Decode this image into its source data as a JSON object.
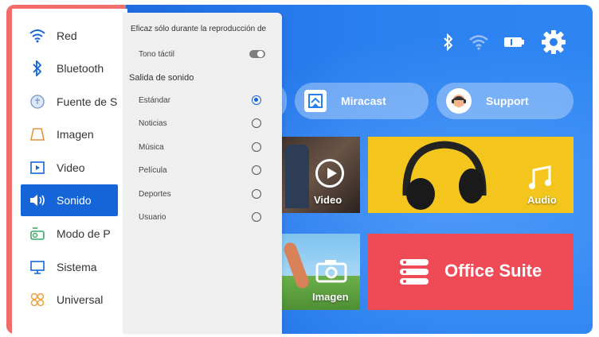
{
  "sidebar": {
    "items": [
      {
        "label": "Red",
        "icon": "wifi-icon"
      },
      {
        "label": "Bluetooth",
        "icon": "bluetooth-icon"
      },
      {
        "label": "Fuente de S",
        "icon": "input-source-icon"
      },
      {
        "label": "Imagen",
        "icon": "image-icon"
      },
      {
        "label": "Video",
        "icon": "video-icon"
      },
      {
        "label": "Sonido",
        "icon": "speaker-icon",
        "active": true
      },
      {
        "label": "Modo de P",
        "icon": "projection-mode-icon"
      },
      {
        "label": "Sistema",
        "icon": "monitor-icon"
      },
      {
        "label": "Universal",
        "icon": "universal-icon"
      }
    ]
  },
  "sound_panel": {
    "header": "Eficaz sólo durante la reproducción de",
    "touch_tone_label": "Tono táctil",
    "touch_tone_on": false,
    "output_section": "Salida de sonido",
    "options": [
      "Estándar",
      "Noticias",
      "Música",
      "Película",
      "Deportes",
      "Usuario"
    ],
    "selected": "Estándar"
  },
  "home": {
    "miracast_label": "Miracast",
    "support_label": "Support",
    "video_label": "Video",
    "audio_label": "Audio",
    "image_label": "Imagen",
    "office_label": "Office Suite"
  },
  "colors": {
    "accent": "#1565d8",
    "audio_tile": "#f3c51d",
    "office_tile": "#ef4b57",
    "sidebar_bg": "#ffffff",
    "panel_bg": "#efefef"
  },
  "status_icons": [
    "bluetooth-icon",
    "wifi-icon",
    "battery-icon",
    "gear-icon"
  ]
}
